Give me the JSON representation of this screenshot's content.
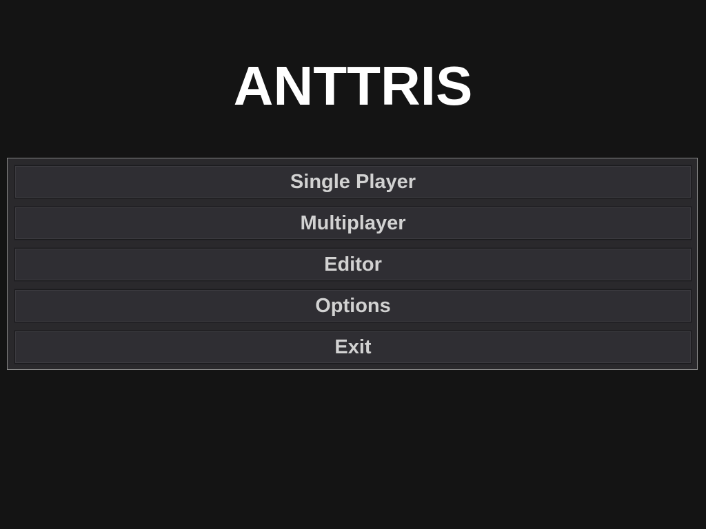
{
  "title": "ANTTRIS",
  "menu": {
    "items": [
      {
        "label": "Single Player"
      },
      {
        "label": "Multiplayer"
      },
      {
        "label": "Editor"
      },
      {
        "label": "Options"
      },
      {
        "label": "Exit"
      }
    ]
  },
  "colors": {
    "background": "#141414",
    "panel": "#2a292c",
    "panel_border": "#8a8a8a",
    "button": "#2f2e33",
    "button_text": "#d2d2d2",
    "title_text": "#ffffff"
  }
}
